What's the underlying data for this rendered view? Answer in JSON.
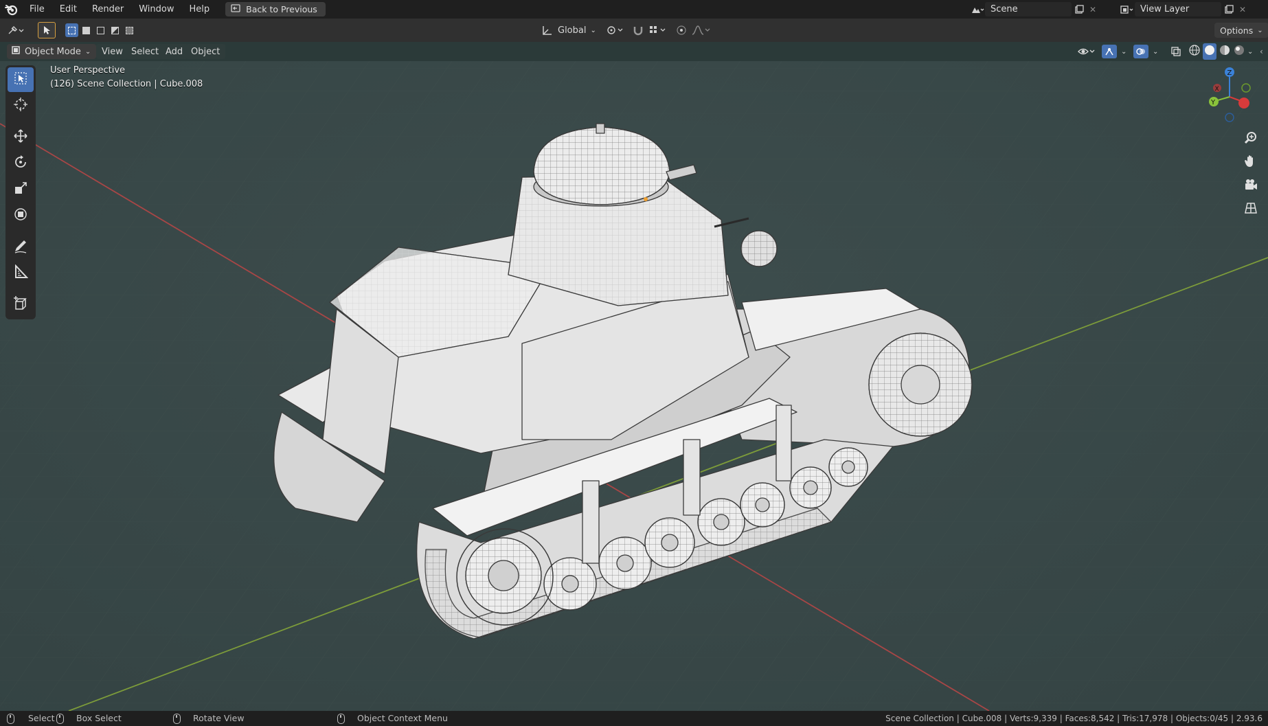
{
  "menu": {
    "items": [
      "File",
      "Edit",
      "Render",
      "Window",
      "Help"
    ],
    "back_button": "Back to Previous"
  },
  "scene": {
    "name": "Scene",
    "view_layer": "View Layer"
  },
  "tool_header": {
    "transform_orientation": "Global",
    "options_label": "Options"
  },
  "view_header": {
    "mode": "Object Mode",
    "menus": [
      "View",
      "Select",
      "Add",
      "Object"
    ]
  },
  "viewport": {
    "perspective_label": "User Perspective",
    "collection_label": "(126) Scene Collection | Cube.008",
    "background_color": "#3a4a4a",
    "x_axis_color": "#b04848",
    "y_axis_color": "#7fa03a",
    "model_color": "#e6e6e6",
    "wire_color": "#4a4a4a"
  },
  "gizmo": {
    "x_label": "X",
    "y_label": "Y",
    "z_label": "Z"
  },
  "left_tools": [
    "select-box-icon",
    "cursor-icon",
    "move-icon",
    "rotate-icon",
    "scale-icon",
    "transform-icon",
    "annotate-icon",
    "measure-icon",
    "add-cube-icon"
  ],
  "status": {
    "select": "Select",
    "box_select": "Box Select",
    "rotate_view": "Rotate View",
    "context_menu": "Object Context Menu",
    "stats": "Scene Collection | Cube.008 | Verts:9,339 | Faces:8,542 | Tris:17,978 | Objects:0/45 | 2.93.6"
  }
}
